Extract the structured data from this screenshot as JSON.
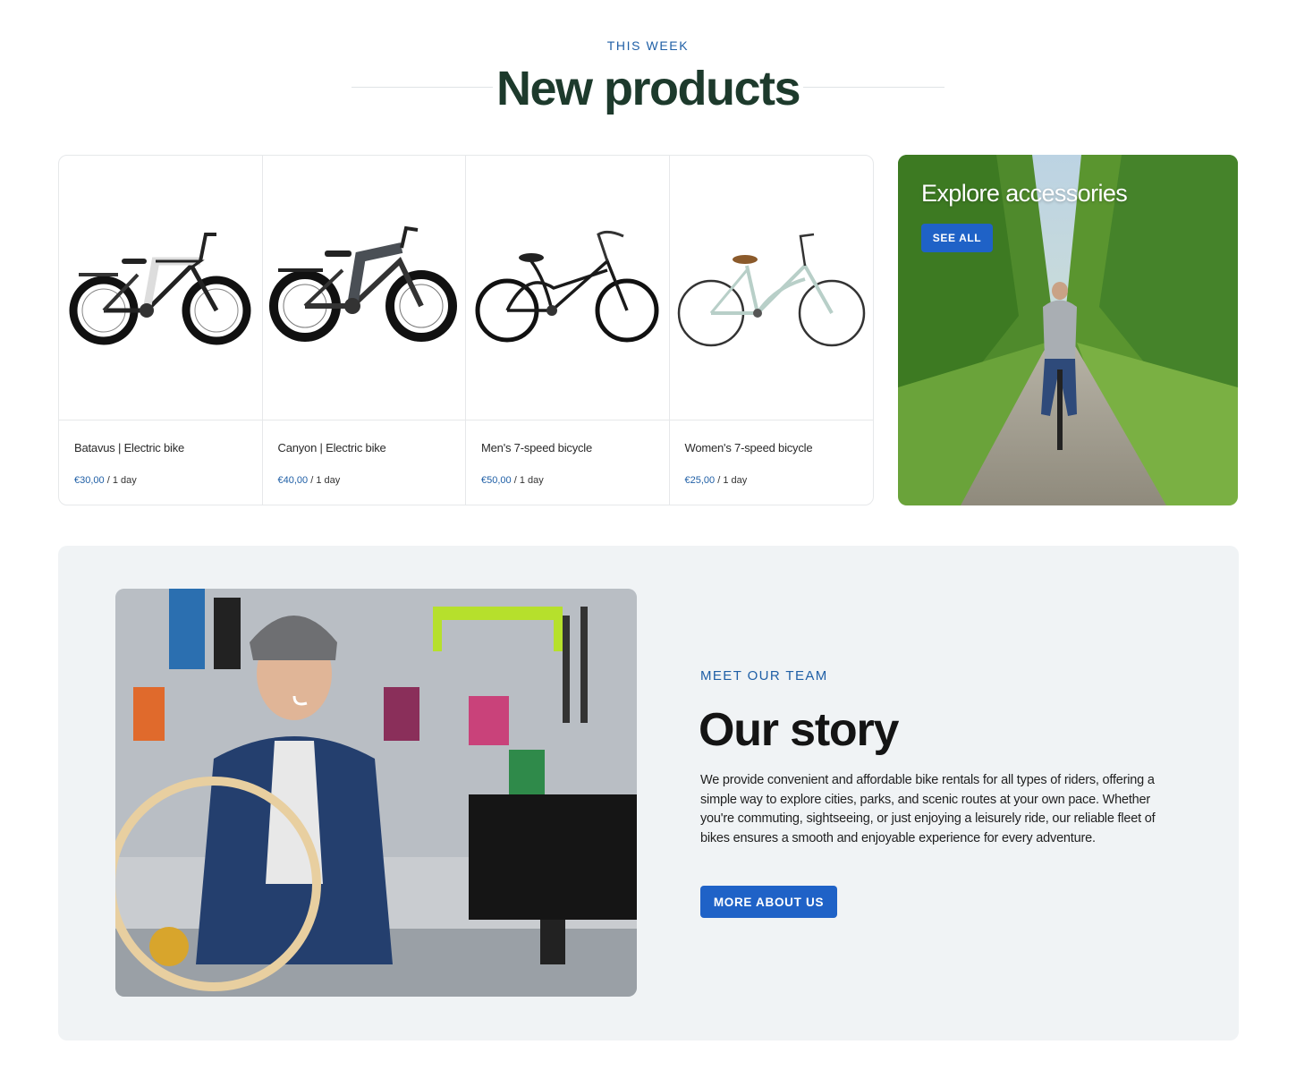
{
  "header": {
    "eyebrow": "THIS WEEK",
    "title": "New products"
  },
  "products": [
    {
      "name": "Batavus | Electric bike",
      "price": "€30,00",
      "period": " / 1 day",
      "image_icon": "electric-bike-white-icon"
    },
    {
      "name": "Canyon | Electric bike",
      "price": "€40,00",
      "period": " / 1 day",
      "image_icon": "electric-bike-grey-icon"
    },
    {
      "name": "Men's 7-speed bicycle",
      "price": "€50,00",
      "period": " / 1 day",
      "image_icon": "cruiser-bike-black-icon"
    },
    {
      "name": "Women's 7-speed bicycle",
      "price": "€25,00",
      "period": " / 1 day",
      "image_icon": "city-bike-mint-icon"
    }
  ],
  "accessories": {
    "title": "Explore accessories",
    "button_label": "SEE ALL"
  },
  "story": {
    "eyebrow": "MEET OUR TEAM",
    "title": "Our story",
    "body": "We provide convenient and affordable bike rentals for all types of riders, offering a simple way to explore cities, parks, and scenic routes at your own pace. Whether you're commuting, sightseeing, or just enjoying a leisurely ride, our reliable fleet of bikes ensures a smooth and enjoyable experience for every adventure.",
    "button_label": "MORE ABOUT US"
  },
  "colors": {
    "accent": "#1f62c7",
    "eyebrow": "#1f5fa6",
    "title_green": "#1d3a2c",
    "story_bg": "#f0f3f5"
  }
}
